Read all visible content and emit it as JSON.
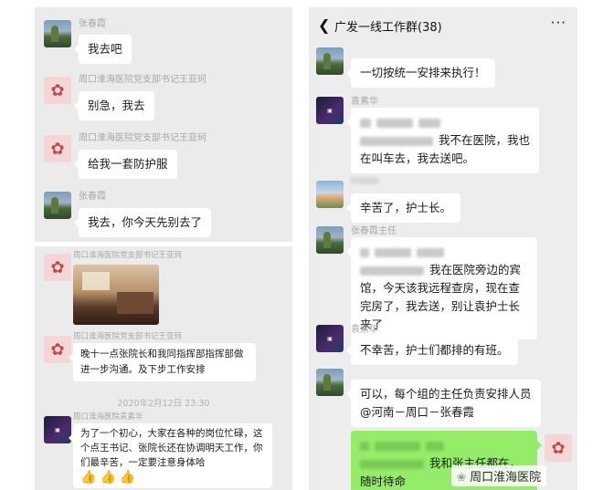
{
  "left_top": {
    "messages": [
      {
        "sender": "张春霞",
        "text": "我去吧"
      },
      {
        "sender": "周口淮海医院党支部书记王亚珂",
        "text": "别急，我去"
      },
      {
        "sender": "周口淮海医院党支部书记王亚珂",
        "text": "给我一套防护服"
      },
      {
        "sender": "张春霞",
        "text": "我去，你今天先别去了"
      }
    ]
  },
  "left_bottom": {
    "sender_1": "周口淮海医院党支部书记王亚珂",
    "sender_2": "周口淮海医院党支部书记王亚珂",
    "message_2": "晚十一点张院长和我同指挥部指挥部做进一步沟通。及下步工作安排",
    "timestamp": "2020年2月12日 23:30",
    "sender_3": "周口淮海医院袁素华",
    "message_3": "为了一个初心，大家在各种的岗位忙碌，这个点王书记、张院长还在协调明天工作，你们最辛苦，一定要注意身体哈",
    "emoji": [
      "👍",
      "👍",
      "👍"
    ]
  },
  "right_chat": {
    "back_icon": "chevron-left-icon",
    "title": "广发一线工作群(38)",
    "more_icon": "more-icon",
    "messages": [
      {
        "sender": "",
        "text": "一切按统一安排来执行！"
      },
      {
        "sender": "袁素华",
        "text": "我不在医院，我也在叫车去，我去送吧。"
      },
      {
        "sender": "",
        "text": "辛苦了，护士长。"
      },
      {
        "sender": "张春霞主任",
        "text": "我在医院旁边的宾馆，今天该我远程查房，现在查完房了，我去送，别让袁护士长来了"
      },
      {
        "sender": "袁素华",
        "text": "不幸苦，护士们都排的有班。"
      },
      {
        "sender": "",
        "text": "可以，每个组的主任负责安排人员@河南－周口－张春霞"
      },
      {
        "sender": "",
        "text": "我和张主任都在，随时待命"
      }
    ]
  },
  "watermark": "周口淮海医院"
}
